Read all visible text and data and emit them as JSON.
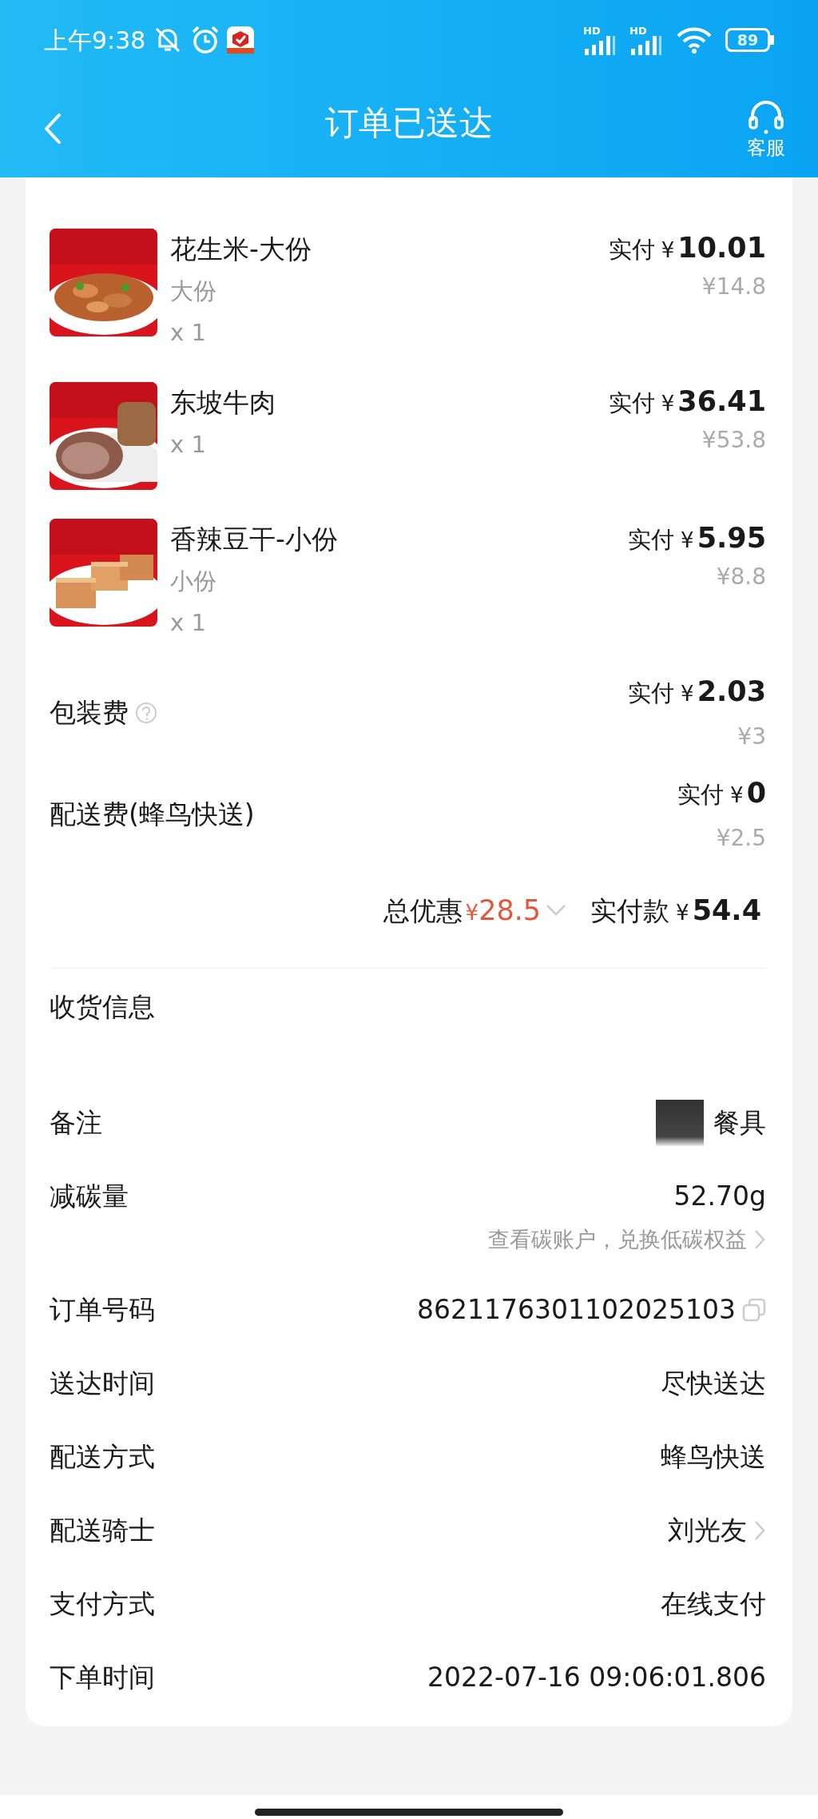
{
  "status_bar": {
    "time": "上午9:38",
    "network_labels": [
      "HD",
      "HD"
    ],
    "battery": "89"
  },
  "header": {
    "title": "订单已送达",
    "service_label": "客服"
  },
  "items": [
    {
      "kind": "picture",
      "name": "花生米-大份",
      "spec": "大份",
      "quantity": "x 1",
      "paid_label": "实付",
      "currency": "¥",
      "amount": "10.01",
      "original": "¥14.8"
    },
    {
      "kind": "picture",
      "name": "东坡牛肉",
      "quantity": "x 1",
      "paid_label": "实付",
      "currency": "¥",
      "amount": "36.41",
      "original": "¥53.8"
    },
    {
      "kind": "picture",
      "name": "香辣豆干-小份",
      "spec": "小份",
      "quantity": "x 1",
      "paid_label": "实付",
      "currency": "¥",
      "amount": "5.95",
      "original": "¥8.8"
    }
  ],
  "fees": [
    {
      "label": "包装费",
      "help": true,
      "paid_label": "实付",
      "currency": "¥",
      "amount": "2.03",
      "original": "¥3"
    },
    {
      "label": "配送费(蜂鸟快送)",
      "help": false,
      "paid_label": "实付",
      "currency": "¥",
      "amount": "0",
      "original": "¥2.5"
    }
  ],
  "summary": {
    "discount_label": "总优惠",
    "discount_currency": "¥",
    "discount": "28.5",
    "paid_label": "实付款",
    "paid_currency": "¥",
    "paid": "54.4"
  },
  "details": [
    {
      "kind": "address",
      "label": "收货信息"
    },
    {
      "kind": "masked",
      "label": "备注",
      "value": "餐具"
    },
    {
      "kind": "carbon",
      "label": "减碳量",
      "value": "52.70g",
      "link": "查看碳账户，兑换低碳权益"
    },
    {
      "kind": "copy",
      "label": "订单号码",
      "value": "8621176301102025103"
    },
    {
      "kind": "text",
      "label": "送达时间",
      "value": "尽快送达"
    },
    {
      "kind": "text",
      "label": "配送方式",
      "value": "蜂鸟快送"
    },
    {
      "kind": "chevron",
      "label": "配送骑士",
      "value": "刘光友"
    },
    {
      "kind": "text",
      "label": "支付方式",
      "value": "在线支付"
    },
    {
      "kind": "text",
      "label": "下单时间",
      "value": "2022-07-16 09:06:01.806"
    }
  ]
}
